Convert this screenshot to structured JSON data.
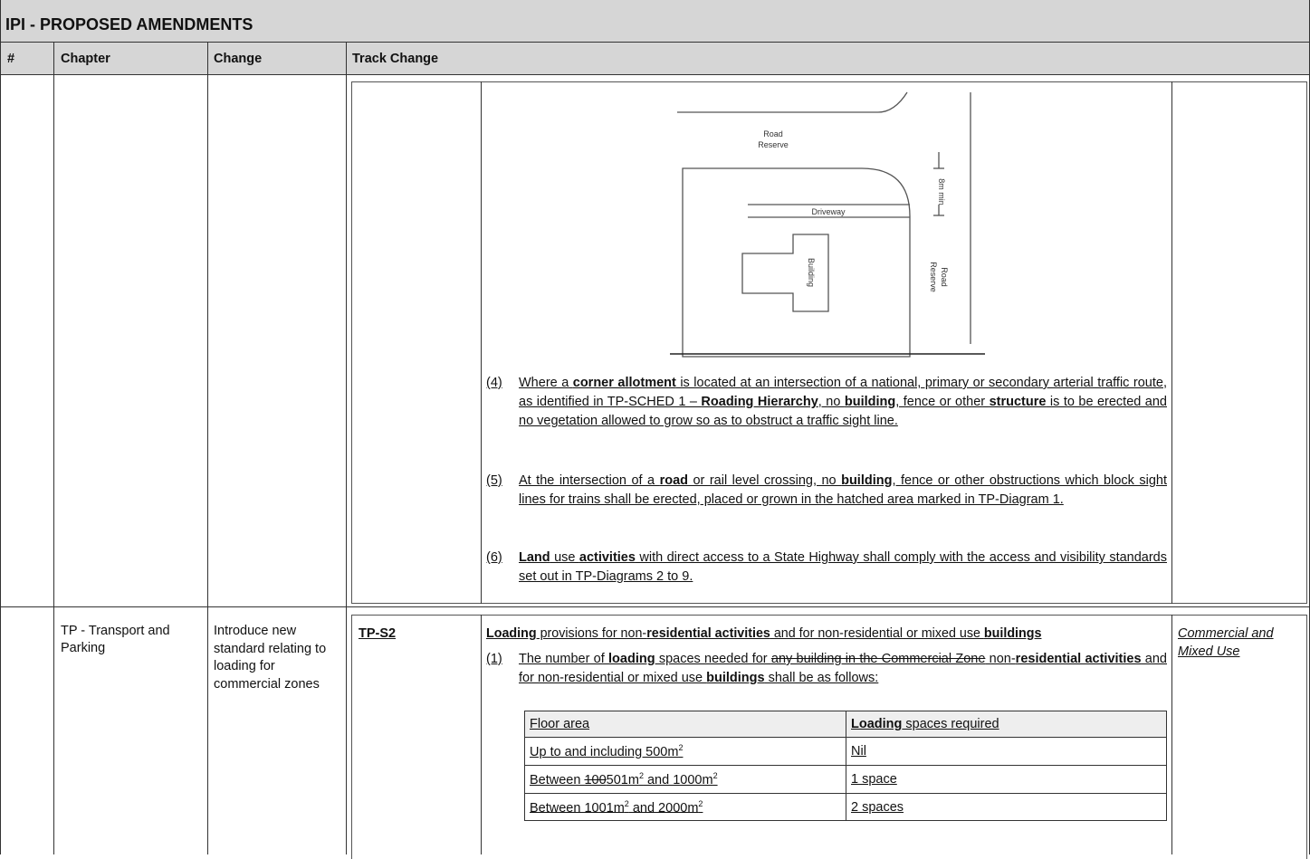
{
  "title": "IPI - PROPOSED AMENDMENTS",
  "headers": {
    "num": "#",
    "chapter": "Chapter",
    "change": "Change",
    "track": "Track Change"
  },
  "diagram": {
    "road_reserve_top_1": "Road",
    "road_reserve_top_2": "Reserve",
    "dim_label": "8m min",
    "driveway": "Driveway",
    "building": "Building",
    "road_reserve_side_1": "Road",
    "road_reserve_side_2": "Reserve"
  },
  "paras": [
    {
      "num": "(4)"
    },
    {
      "num": "(5)"
    },
    {
      "num": "(6)"
    }
  ],
  "row2": {
    "chapter": "TP - Transport and Parking",
    "change": "Introduce new standard relating to loading for commercial zones",
    "code": "TP-S2",
    "zone": "Commercial and Mixed Use"
  },
  "loading_table": {
    "header_floor": "Floor area",
    "header_spaces_bold": "Loading",
    "header_spaces_rest": " spaces required",
    "rows": [
      {
        "spaces": "Nil"
      },
      {
        "spaces": "1 space"
      },
      {
        "spaces": "2 spaces"
      }
    ]
  }
}
